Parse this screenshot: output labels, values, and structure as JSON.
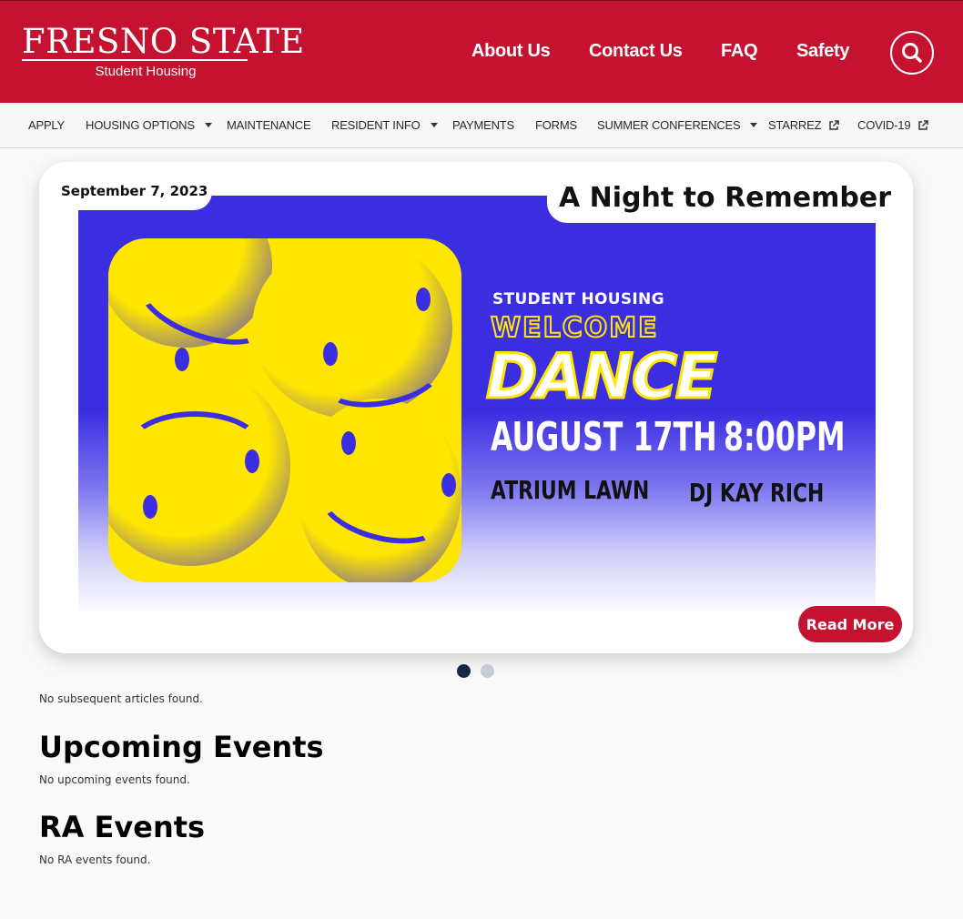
{
  "brand": {
    "logo_main": "FRESNO STATE",
    "logo_sub": "Student Housing",
    "primary_color": "#c41230",
    "navy": "#13294b"
  },
  "top_nav": [
    {
      "label": "About Us"
    },
    {
      "label": "Contact Us"
    },
    {
      "label": "FAQ"
    },
    {
      "label": "Safety"
    }
  ],
  "search": {
    "icon": "search-icon"
  },
  "sub_nav": [
    {
      "label": "APPLY",
      "dropdown": false,
      "external": false
    },
    {
      "label": "HOUSING OPTIONS",
      "dropdown": true,
      "external": false
    },
    {
      "label": "MAINTENANCE",
      "dropdown": false,
      "external": false
    },
    {
      "label": "RESIDENT INFO",
      "dropdown": true,
      "external": false
    },
    {
      "label": "PAYMENTS",
      "dropdown": false,
      "external": false
    },
    {
      "label": "FORMS",
      "dropdown": false,
      "external": false
    },
    {
      "label": "SUMMER CONFERENCES",
      "dropdown": true,
      "external": false
    },
    {
      "label": "STARREZ",
      "dropdown": false,
      "external": true
    },
    {
      "label": "COVID-19",
      "dropdown": false,
      "external": true
    }
  ],
  "featured": {
    "date": "September 7, 2023",
    "title": "A Night to Remember",
    "read_more": "Read More",
    "poster": {
      "line1": "STUDENT HOUSING",
      "line2": "WELCOME",
      "line3": "DANCE",
      "date": "AUGUST 17TH",
      "time": "8:00PM",
      "location": "ATRIUM LAWN",
      "dj": "DJ KAY RICH",
      "colors": {
        "blue": "#3b2ee0",
        "yellow": "#ffe600"
      }
    }
  },
  "carousel": {
    "current": 1,
    "total": 2
  },
  "sections": {
    "no_articles": "No subsequent articles found.",
    "upcoming_title": "Upcoming Events",
    "upcoming_empty": "No upcoming events found.",
    "ra_title": "RA Events",
    "ra_empty": "No RA events found."
  }
}
